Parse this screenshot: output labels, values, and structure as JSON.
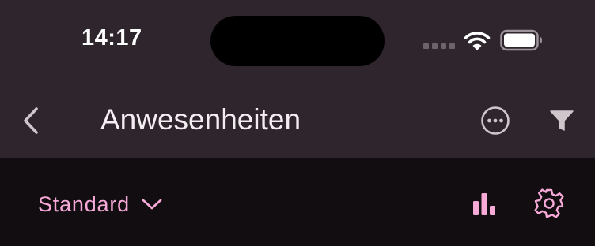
{
  "status_bar": {
    "time": "14:17",
    "signal_icon": "cellular-signal-icon",
    "wifi_icon": "wifi-icon",
    "battery_icon": "battery-icon"
  },
  "nav_bar": {
    "back_icon": "chevron-left-icon",
    "title": "Anwesenheiten",
    "more_icon": "ellipsis-circle-icon",
    "filter_icon": "filter-icon"
  },
  "toolbar": {
    "view_select": {
      "selected": "Standard",
      "icon": "chevron-down-icon"
    },
    "stats_icon": "bar-chart-icon",
    "settings_icon": "gear-icon"
  },
  "colors": {
    "nav_background": "#2e262c",
    "toolbar_background": "#120d10",
    "accent": "#f7a9d8",
    "text": "#f4eef2",
    "icon_muted": "#cfc6cb"
  }
}
